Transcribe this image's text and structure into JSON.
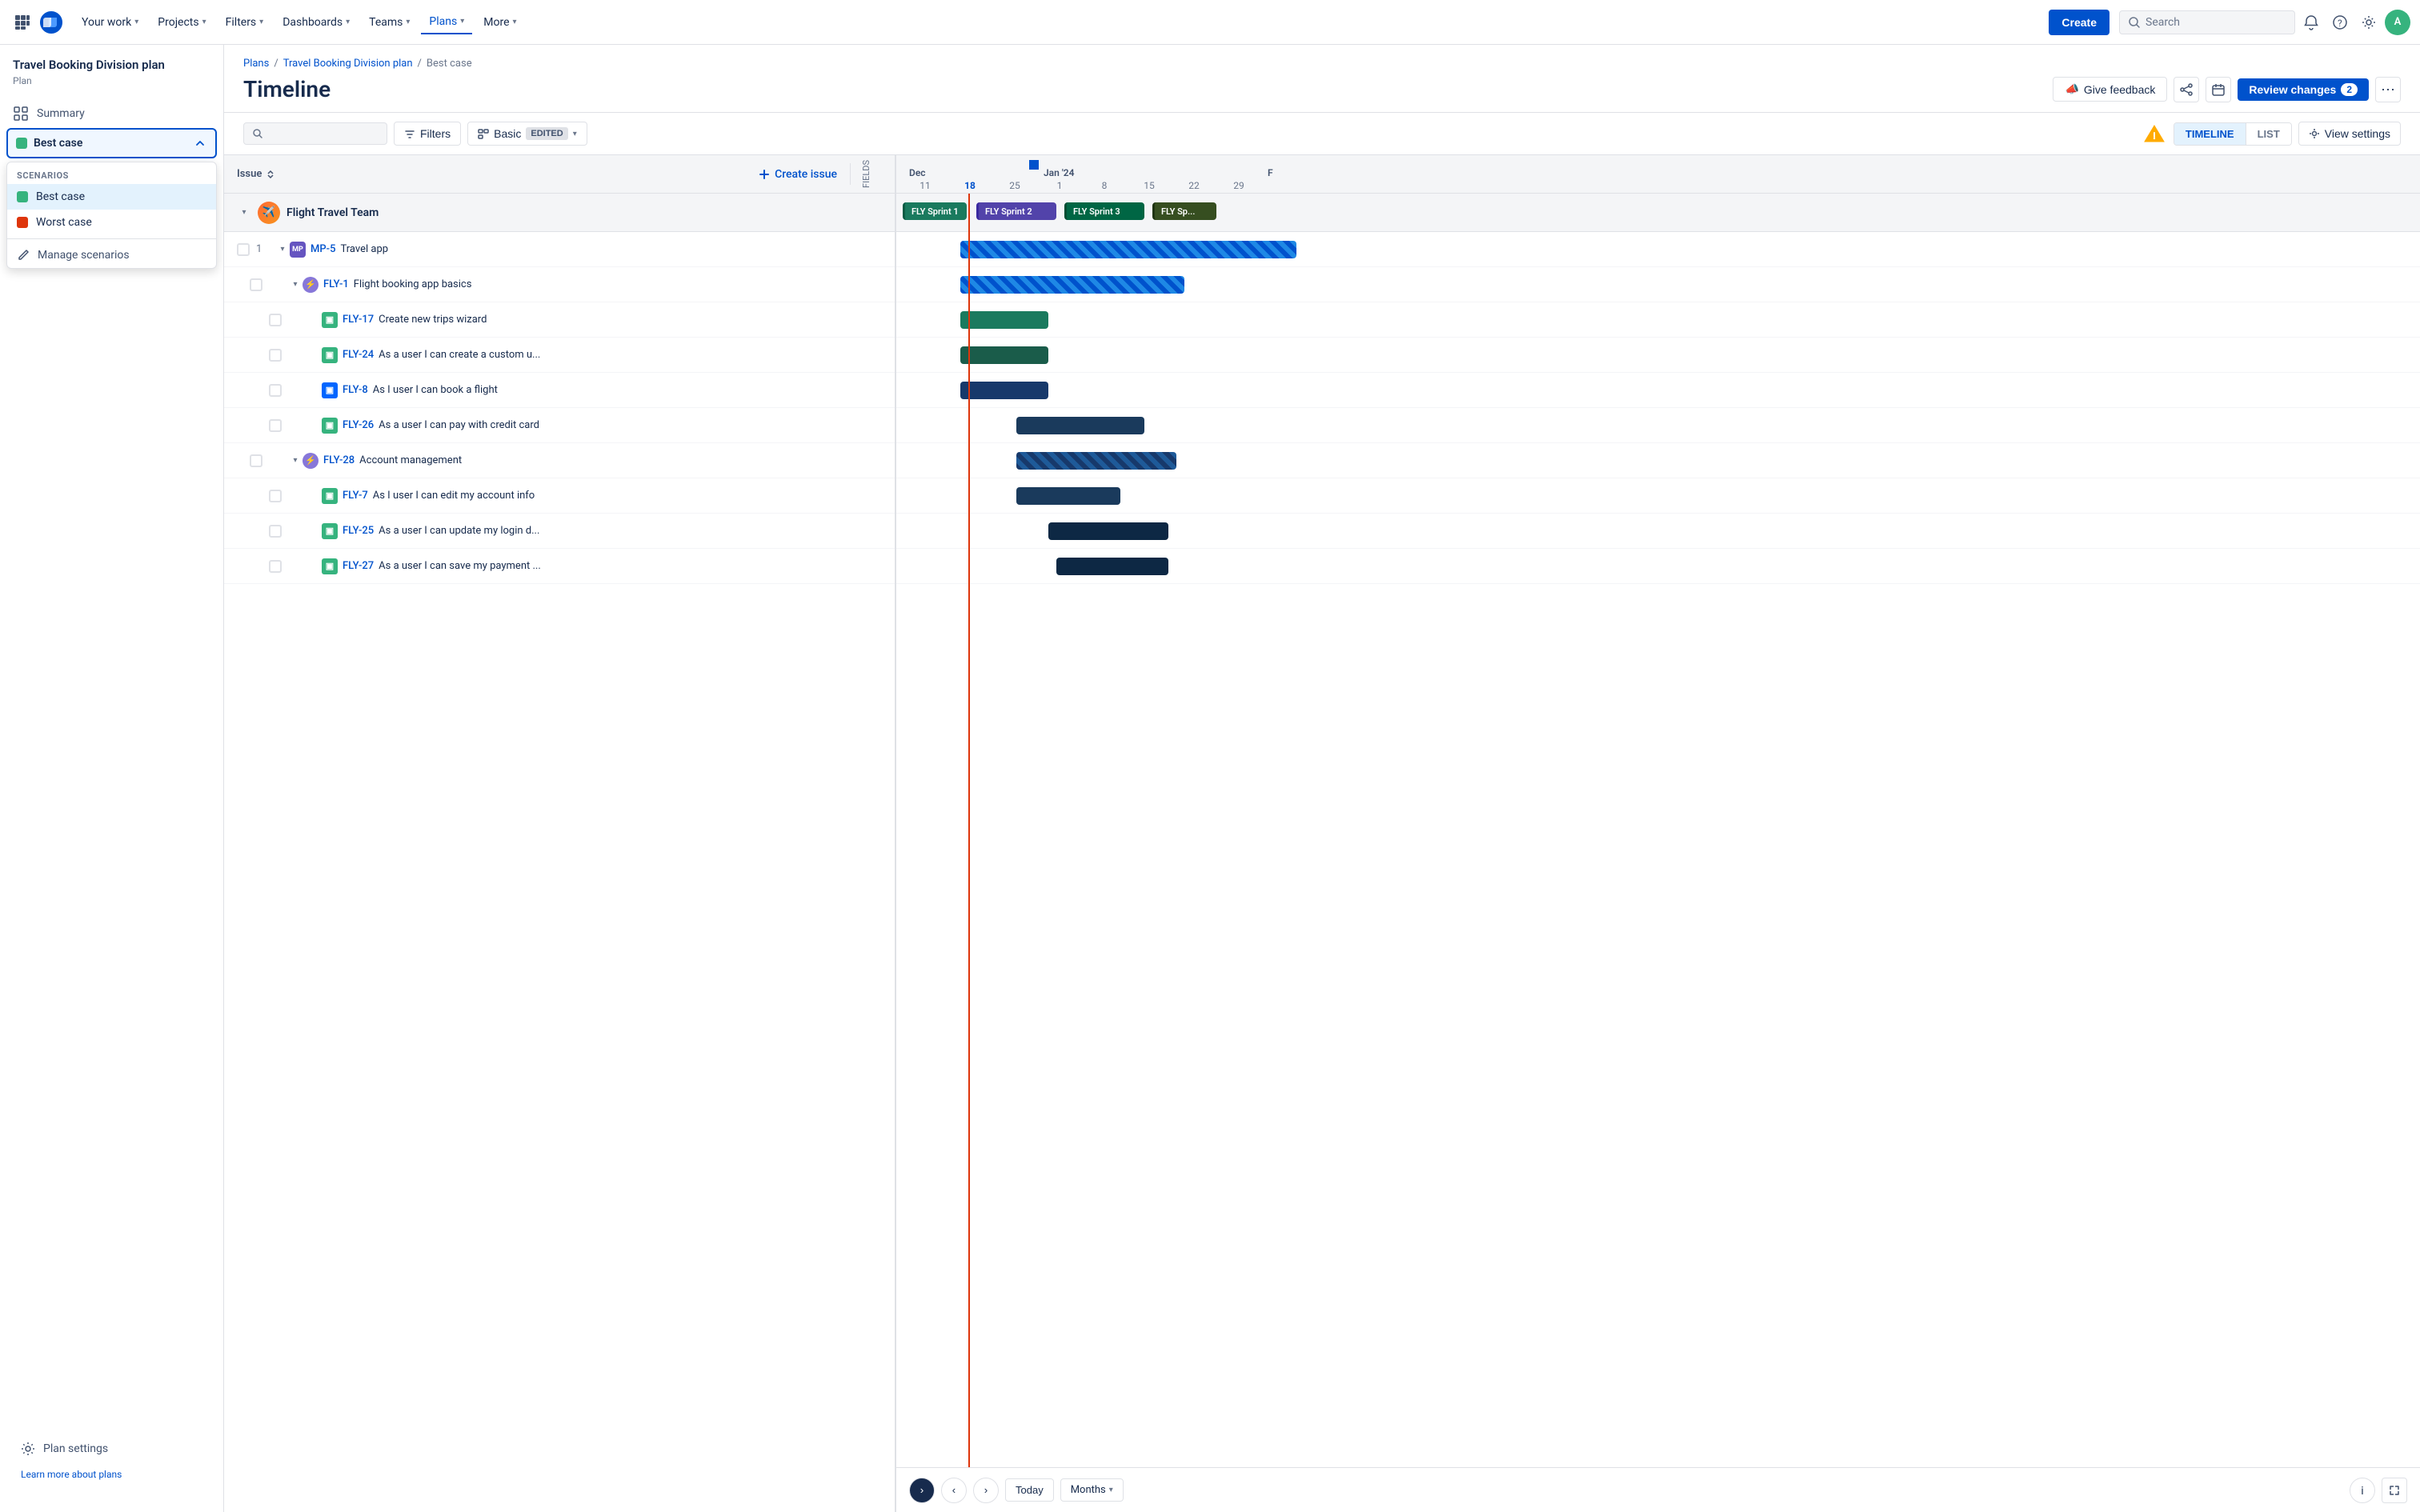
{
  "nav": {
    "apps_label": "Apps",
    "items": [
      {
        "label": "Your work",
        "active": false
      },
      {
        "label": "Projects",
        "active": false
      },
      {
        "label": "Filters",
        "active": false
      },
      {
        "label": "Dashboards",
        "active": false
      },
      {
        "label": "Teams",
        "active": false
      },
      {
        "label": "Plans",
        "active": true
      },
      {
        "label": "More",
        "active": false
      }
    ],
    "create_label": "Create",
    "search_placeholder": "Search",
    "avatar_initials": "A"
  },
  "sidebar": {
    "title": "Travel Booking Division plan",
    "subtitle": "Plan",
    "summary_label": "Summary",
    "scenario_selected": "Best case",
    "scenarios_section": "SCENARIOS",
    "scenarios": [
      {
        "label": "Best case",
        "color": "green",
        "selected": true
      },
      {
        "label": "Worst case",
        "color": "red",
        "selected": false
      }
    ],
    "manage_label": "Manage scenarios",
    "plan_settings_label": "Plan settings",
    "learn_label": "Learn more about plans"
  },
  "breadcrumb": {
    "items": [
      "Plans",
      "Travel Booking Division plan",
      "Best case"
    ]
  },
  "header": {
    "title": "Timeline",
    "feedback_label": "Give feedback",
    "review_label": "Review changes",
    "review_count": "2"
  },
  "toolbar": {
    "filters_label": "Filters",
    "groupby_label": "Basic",
    "edited_label": "EDITED",
    "timeline_label": "TIMELINE",
    "list_label": "LIST",
    "view_settings_label": "View settings"
  },
  "issue_table": {
    "col_header": "Issue",
    "create_issue_label": "Create issue",
    "fields_label": "FIELDS",
    "groups": [
      {
        "name": "Flight Travel Team",
        "items": [
          {
            "num": "1",
            "key": "MP-5",
            "title": "Travel app",
            "icon_type": "mp",
            "indent": 0,
            "children": [
              {
                "key": "FLY-1",
                "title": "Flight booking app basics",
                "icon_type": "epic",
                "indent": 1,
                "children": [
                  {
                    "key": "FLY-17",
                    "title": "Create new trips wizard",
                    "icon_type": "story-green",
                    "indent": 2
                  },
                  {
                    "key": "FLY-24",
                    "title": "As a user I can create a custom u...",
                    "icon_type": "story-green",
                    "indent": 2
                  },
                  {
                    "key": "FLY-8",
                    "title": "As I user I can book a flight",
                    "icon_type": "story-blue",
                    "indent": 2
                  },
                  {
                    "key": "FLY-26",
                    "title": "As a user I can pay with credit card",
                    "icon_type": "story-green",
                    "indent": 2
                  }
                ]
              },
              {
                "key": "FLY-28",
                "title": "Account management",
                "icon_type": "epic",
                "indent": 1,
                "children": [
                  {
                    "key": "FLY-7",
                    "title": "As I user I can edit my account info",
                    "icon_type": "story-green",
                    "indent": 2
                  },
                  {
                    "key": "FLY-25",
                    "title": "As a user I can update my login d...",
                    "icon_type": "story-green",
                    "indent": 2
                  },
                  {
                    "key": "FLY-27",
                    "title": "As a user I can save my payment ...",
                    "icon_type": "story-green",
                    "indent": 2
                  }
                ]
              }
            ]
          }
        ]
      }
    ]
  },
  "gantt": {
    "months": [
      {
        "label": "Dec",
        "dates": [
          "11",
          "18",
          "25"
        ]
      },
      {
        "label": "Jan '24",
        "dates": [
          "1",
          "8",
          "15",
          "22",
          "29"
        ]
      },
      {
        "label": "F"
      }
    ],
    "today_label": "Today",
    "months_label": "Months",
    "nav_prev": "‹",
    "nav_next": "›"
  }
}
